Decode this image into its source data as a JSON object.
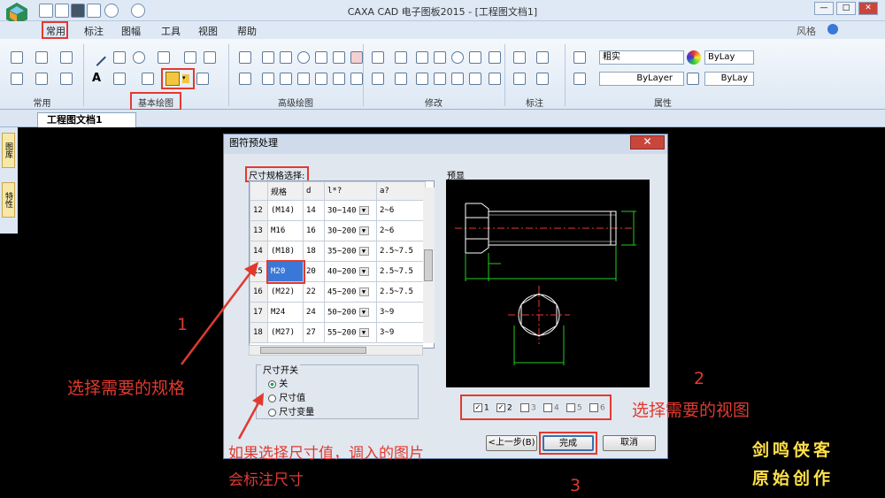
{
  "app": {
    "title": "CAXA CAD 电子图板2015 - [工程图文档1]",
    "style_label": "风格",
    "win_min": "—",
    "win_max": "□",
    "win_close": "✕"
  },
  "menu": [
    "常用",
    "标注",
    "图幅",
    "工具",
    "视图",
    "帮助"
  ],
  "ribbon": {
    "groups": [
      "常用",
      "基本绘图",
      "高级绘图",
      "修改",
      "标注",
      "属性"
    ],
    "line_style": "粗实",
    "layer1": "ByLay",
    "layer2": "ByLayer",
    "layer3": "ByLay",
    "color_label": "ByLayer"
  },
  "doc_tab": "工程图文档1",
  "left_tabs": [
    "图库",
    "特性"
  ],
  "dialog": {
    "title": "图符预处理",
    "close": "✕",
    "spec_title": "尺寸规格选择:",
    "columns": [
      "",
      "规格",
      "d",
      "l*?",
      "a?"
    ],
    "rows": [
      {
        "n": "12",
        "spec": "(M14)",
        "d": "14",
        "l": "30~140",
        "a": "2~6"
      },
      {
        "n": "13",
        "spec": "M16",
        "d": "16",
        "l": "30~200",
        "a": "2~6"
      },
      {
        "n": "14",
        "spec": "(M18)",
        "d": "18",
        "l": "35~200",
        "a": "2.5~7.5"
      },
      {
        "n": "15",
        "spec": "M20",
        "d": "20",
        "l": "40~200",
        "a": "2.5~7.5"
      },
      {
        "n": "16",
        "spec": "(M22)",
        "d": "22",
        "l": "45~200",
        "a": "2.5~7.5"
      },
      {
        "n": "17",
        "spec": "M24",
        "d": "24",
        "l": "50~200",
        "a": "3~9"
      },
      {
        "n": "18",
        "spec": "(M27)",
        "d": "27",
        "l": "55~200",
        "a": "3~9"
      }
    ],
    "preview_label": "预显",
    "dim_switch": "尺寸开关",
    "dim_options": [
      "关",
      "尺寸值",
      "尺寸变量"
    ],
    "views": [
      "1",
      "2",
      "3",
      "4",
      "5",
      "6"
    ],
    "views_checked": [
      true,
      true,
      false,
      false,
      false,
      false
    ],
    "btn_prev": "<上一步(B)",
    "btn_finish": "完成",
    "btn_cancel": "取消"
  },
  "annotations": {
    "n1": "1",
    "t1": "选择需要的规格",
    "n2": "2",
    "t2": "选择需要的视图",
    "n3": "3",
    "t3a": "如果选择尺寸值，调入的图片",
    "t3b": "会标注尺寸"
  },
  "watermark": {
    "l1": "剑鸣侠客",
    "l2": "原始创作"
  },
  "colors": {
    "annotation": "#e03a2f",
    "watermark": "#ffe04a",
    "selected": "#3a78d8"
  }
}
